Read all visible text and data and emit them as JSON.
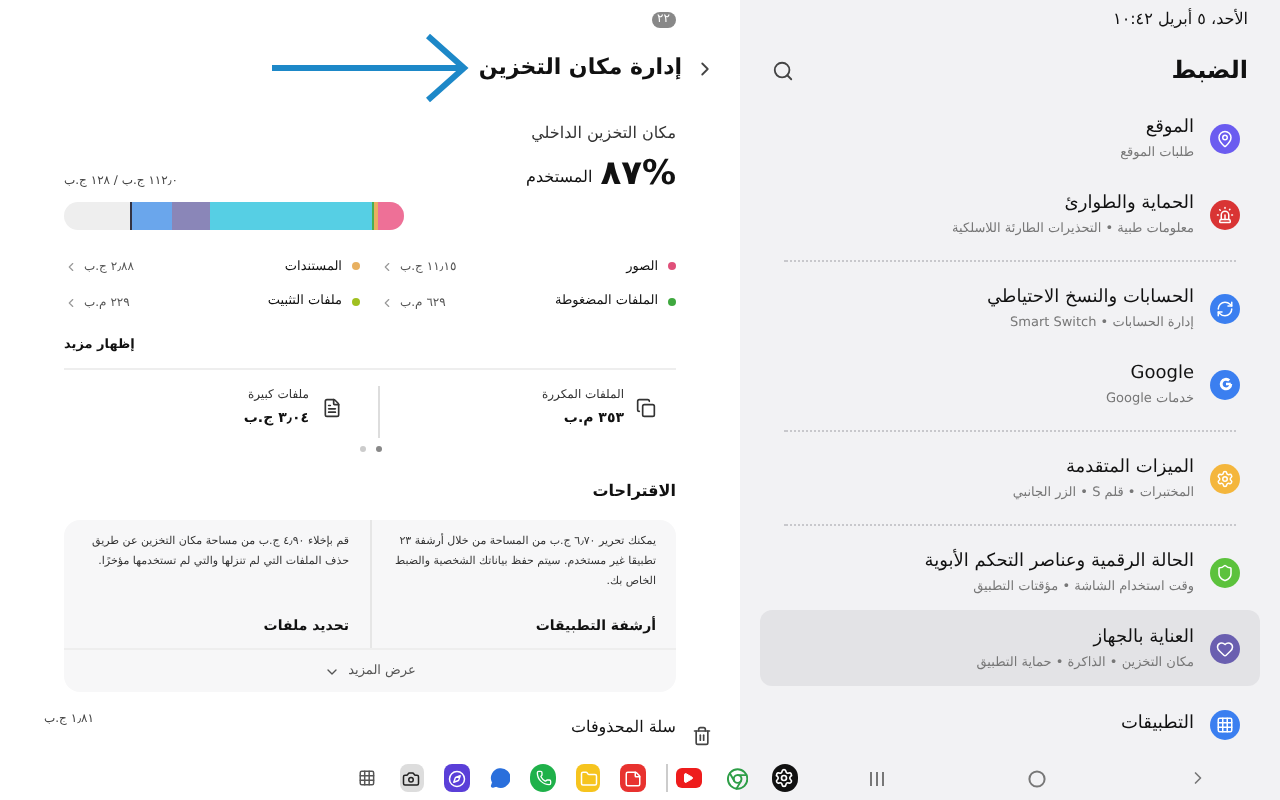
{
  "status_bar": {
    "date_time": "الأحد، ٥ أبريل ١٠:٤٢",
    "battery": "٢٢"
  },
  "settings": {
    "title": "الضبط",
    "items": [
      {
        "title": "الموقع",
        "subtitle": "طلبات الموقع",
        "color": "#6b5cf0",
        "selected": false,
        "divider_after": false
      },
      {
        "title": "الحماية والطوارئ",
        "subtitle": "معلومات طبية • التحذيرات الطارئة اللاسلكية",
        "color": "#d93434",
        "selected": false,
        "divider_after": true
      },
      {
        "title": "الحسابات والنسخ الاحتياطي",
        "subtitle": "إدارة الحسابات • Smart Switch",
        "color": "#3b7ff0",
        "selected": false,
        "divider_after": false
      },
      {
        "title": "Google",
        "subtitle": "خدمات Google",
        "color": "#3b7ff0",
        "selected": false,
        "divider_after": true
      },
      {
        "title": "الميزات المتقدمة",
        "subtitle": "المختبرات • قلم S • الزر الجانبي",
        "color": "#f4b63c",
        "selected": false,
        "divider_after": true
      },
      {
        "title": "الحالة الرقمية وعناصر التحكم الأبوية",
        "subtitle": "وقت استخدام الشاشة • مؤقتات التطبيق",
        "color": "#5cc23c",
        "selected": false,
        "divider_after": false
      },
      {
        "title": "العناية بالجهاز",
        "subtitle": "مكان التخزين • الذاكرة • حماية التطبيق",
        "color": "#6a5fb0",
        "selected": true,
        "divider_after": false
      },
      {
        "title": "التطبيقات",
        "color": "#3b7ff0",
        "selected": false,
        "divider_after": false
      }
    ]
  },
  "storage": {
    "title": "إدارة مكان التخزين",
    "label": "مكان التخزين الداخلي",
    "percent": "%٨٧",
    "used_label": "المستخدم",
    "total": "١١٢٫٠ ج.ب / ١٢٨ ج.ب",
    "segments": [
      {
        "color": "#ee7097"
      },
      {
        "color": "#e8b060"
      },
      {
        "color": "#4caf50"
      },
      {
        "color": "#56cfe4"
      },
      {
        "color": "#8a86b8"
      },
      {
        "color": "#6aa6ec"
      },
      {
        "color": "#333344"
      }
    ],
    "legend": [
      {
        "label": "الصور",
        "size": "١١٫١٥ ج.ب",
        "color": "#e0507a"
      },
      {
        "label": "المستندات",
        "size": "٢٫٨٨ ج.ب",
        "color": "#e8b060"
      },
      {
        "label": "الملفات المضغوطة",
        "size": "٦٢٩ م.ب",
        "color": "#3fa83f"
      },
      {
        "label": "ملفات التثبيت",
        "size": "٢٢٩ م.ب",
        "color": "#a0c020"
      }
    ],
    "show_more": "إظهار مزيد",
    "files": [
      {
        "label": "الملفات المكررة",
        "size": "٣٥٣ م.ب"
      },
      {
        "label": "ملفات كبيرة",
        "size": "٣٫٠٤ ج.ب"
      }
    ],
    "suggestions_title": "الاقتراحات",
    "suggestions": [
      {
        "text": "يمكنك تحرير ٦٫٧٠ ج.ب من المساحة من خلال أرشفة ٢٣ تطبيقا غير مستخدم. سيتم حفظ بياناتك الشخصية والضبط الخاص بك.",
        "action": "أرشفة التطبيقات"
      },
      {
        "text": "قم بإخلاء ٤٫٩٠ ج.ب من مساحة مكان التخزين عن طريق حذف الملفات التي لم تنزلها والتي لم تستخدمها مؤخرًا.",
        "action": "تحديد ملفات"
      }
    ],
    "view_more": "عرض المزيد",
    "trash": {
      "title": "سلة المحذوفات",
      "size": "١٫٨١ ج.ب"
    }
  }
}
